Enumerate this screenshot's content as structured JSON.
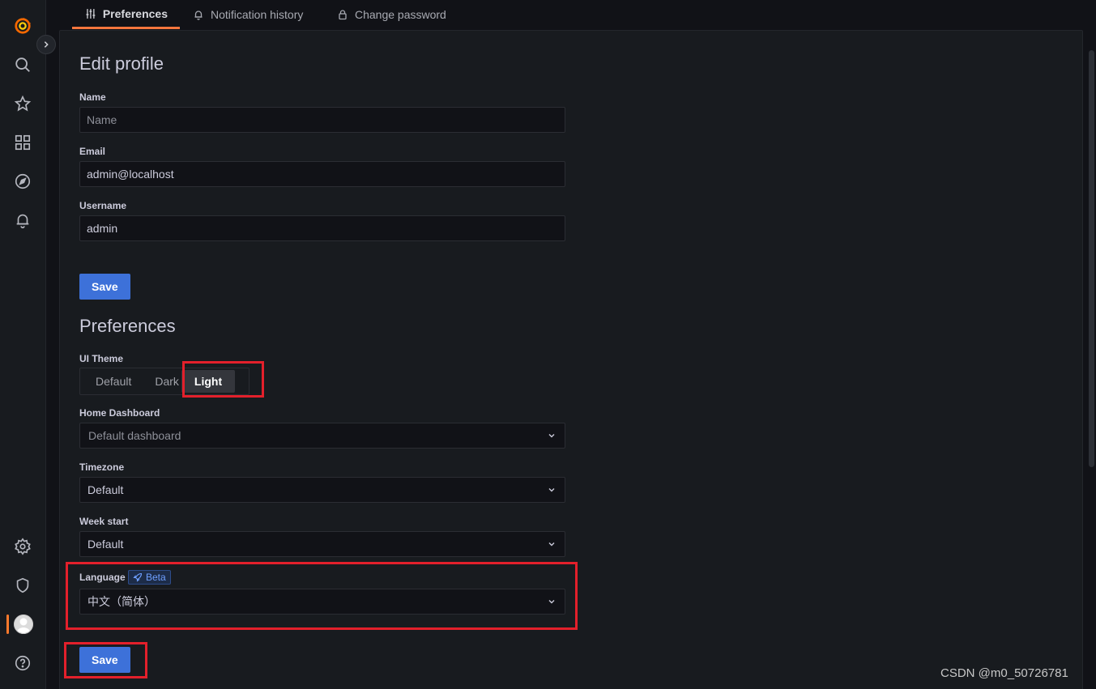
{
  "tabs": [
    {
      "label": "Preferences",
      "icon": "sliders-icon"
    },
    {
      "label": "Notification history",
      "icon": "bell-icon"
    },
    {
      "label": "Change password",
      "icon": "lock-icon"
    }
  ],
  "edit_profile": {
    "title": "Edit profile",
    "name_label": "Name",
    "name_placeholder": "Name",
    "email_label": "Email",
    "email_value": "admin@localhost",
    "username_label": "Username",
    "username_value": "admin",
    "save_label": "Save"
  },
  "preferences": {
    "title": "Preferences",
    "theme_label": "UI Theme",
    "theme_options": [
      "Default",
      "Dark",
      "Light"
    ],
    "theme_selected": "Light",
    "home_label": "Home Dashboard",
    "home_value": "Default dashboard",
    "timezone_label": "Timezone",
    "timezone_value": "Default",
    "week_label": "Week start",
    "week_value": "Default",
    "language_label": "Language",
    "language_badge": "Beta",
    "language_value": "中文（简体）",
    "save_label": "Save"
  },
  "watermark": "CSDN @m0_50726781",
  "colors": {
    "accent": "#3d71d9",
    "tab_underline": "#f5763d",
    "annotation": "#e3202b",
    "background": "#111217",
    "panel": "#181b1f"
  }
}
